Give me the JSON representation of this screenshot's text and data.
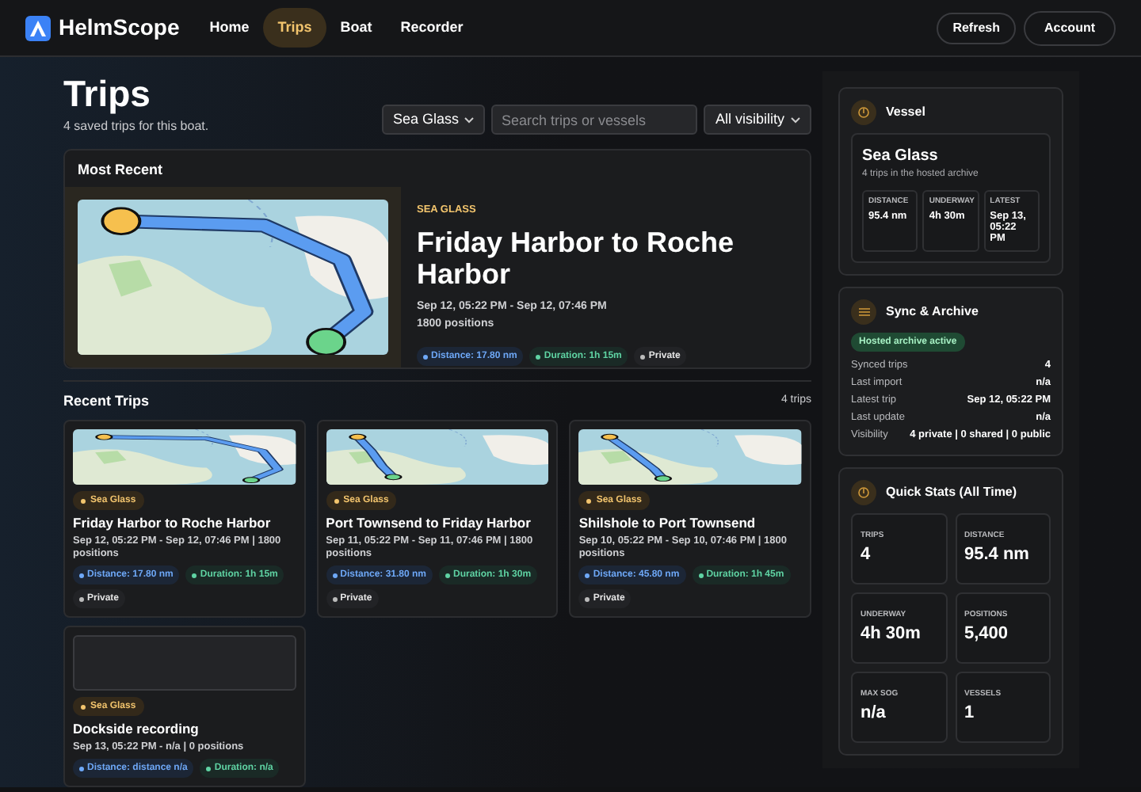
{
  "nav": {
    "brand": "HelmScope",
    "links": [
      {
        "label": "Home",
        "selected": false
      },
      {
        "label": "Trips",
        "selected": true
      },
      {
        "label": "Boat",
        "selected": false
      },
      {
        "label": "Recorder",
        "selected": false
      }
    ],
    "buttons": [
      "Refresh",
      "Account"
    ]
  },
  "header": {
    "title": "Trips",
    "subtitle": "4 saved trips for this boat.",
    "vessel_select": "Sea Glass",
    "search": {
      "placeholder": "Search trips or vessels"
    },
    "visibility_select": "All visibility"
  },
  "most_recent": {
    "heading": "Most Recent",
    "vessel": "SEA GLASS",
    "title": "Friday Harbor to Roche Harbor",
    "time_range": "Sep 12, 05:22 PM - Sep 12, 07:46 PM",
    "positions": "1800 positions",
    "chips": [
      {
        "kind": "distance",
        "text": "Distance: 17.80 nm"
      },
      {
        "kind": "duration",
        "text": "Duration: 1h 15m"
      },
      {
        "kind": "visibility",
        "text": "Private"
      }
    ]
  },
  "recent": {
    "heading": "Recent Trips",
    "count": "4 trips",
    "trips": [
      {
        "map": true,
        "vessel": "Sea Glass",
        "title": "Friday Harbor to Roche Harbor",
        "details": "Sep 12, 05:22 PM - Sep 12, 07:46 PM | 1800 positions",
        "chips": [
          {
            "kind": "distance",
            "text": "Distance: 17.80 nm"
          },
          {
            "kind": "duration",
            "text": "Duration: 1h 15m"
          },
          {
            "kind": "visibility",
            "text": "Private"
          }
        ]
      },
      {
        "map": true,
        "vessel": "Sea Glass",
        "title": "Port Townsend to Friday Harbor",
        "details": "Sep 11, 05:22 PM - Sep 11, 07:46 PM | 1800 positions",
        "chips": [
          {
            "kind": "distance",
            "text": "Distance: 31.80 nm"
          },
          {
            "kind": "duration",
            "text": "Duration: 1h 30m"
          },
          {
            "kind": "visibility",
            "text": "Private"
          }
        ]
      },
      {
        "map": true,
        "vessel": "Sea Glass",
        "title": "Shilshole to Port Townsend",
        "details": "Sep 10, 05:22 PM - Sep 10, 07:46 PM | 1800 positions",
        "chips": [
          {
            "kind": "distance",
            "text": "Distance: 45.80 nm"
          },
          {
            "kind": "duration",
            "text": "Duration: 1h 45m"
          },
          {
            "kind": "visibility",
            "text": "Private"
          }
        ]
      },
      {
        "map": false,
        "vessel": "Sea Glass",
        "title": "Dockside recording",
        "details": "Sep 13, 05:22 PM - n/a | 0 positions",
        "chips": [
          {
            "kind": "distance",
            "text": "Distance: distance n/a"
          },
          {
            "kind": "duration",
            "text": "Duration: n/a"
          }
        ]
      }
    ]
  },
  "sidebar": {
    "vessel": {
      "heading": "Vessel",
      "name": "Sea Glass",
      "subtitle": "4 trips in the hosted archive",
      "stats": [
        {
          "label": "DISTANCE",
          "value": "95.4 nm"
        },
        {
          "label": "UNDERWAY",
          "value": "4h 30m"
        },
        {
          "label": "LATEST",
          "value": "Sep 13, 05:22 PM"
        }
      ]
    },
    "sync": {
      "heading": "Sync & Archive",
      "badge": "Hosted archive active",
      "rows": [
        {
          "label": "Synced trips",
          "value": "4"
        },
        {
          "label": "Last import",
          "value": "n/a"
        },
        {
          "label": "Latest trip",
          "value": "Sep 12, 05:22 PM"
        },
        {
          "label": "Last update",
          "value": "n/a"
        },
        {
          "label": "Visibility",
          "value": "4 private | 0 shared | 0 public"
        }
      ]
    },
    "quick_stats": {
      "heading": "Quick Stats (All Time)",
      "stats": [
        {
          "label": "TRIPS",
          "value": "4"
        },
        {
          "label": "DISTANCE",
          "value": "95.4 nm"
        },
        {
          "label": "UNDERWAY",
          "value": "4h 30m"
        },
        {
          "label": "POSITIONS",
          "value": "5,400"
        },
        {
          "label": "MAX SOG",
          "value": "n/a"
        },
        {
          "label": "VESSELS",
          "value": "1"
        }
      ]
    }
  }
}
